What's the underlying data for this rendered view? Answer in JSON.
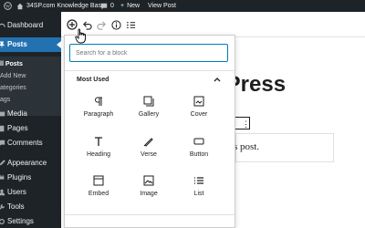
{
  "adminbar": {
    "site_name": "34SP.com Knowledge Base",
    "comments_count": "0",
    "new_label": "New",
    "view_post_label": "View Post"
  },
  "sidebar": {
    "items": [
      {
        "label": "Dashboard",
        "icon": "dashboard-icon"
      },
      {
        "label": "Posts",
        "icon": "pin-icon",
        "active": true
      },
      {
        "label": "Media",
        "icon": "media-icon"
      },
      {
        "label": "Pages",
        "icon": "pages-icon"
      },
      {
        "label": "Comments",
        "icon": "comments-icon"
      },
      {
        "label": "Appearance",
        "icon": "brush-icon"
      },
      {
        "label": "Plugins",
        "icon": "plugin-icon"
      },
      {
        "label": "Users",
        "icon": "users-icon"
      },
      {
        "label": "Tools",
        "icon": "wrench-icon"
      },
      {
        "label": "Settings",
        "icon": "settings-icon"
      }
    ],
    "submenu": [
      "ll Posts",
      "Add New",
      "ategories",
      "ags"
    ]
  },
  "editor": {
    "title_partial": "lPress",
    "paragraph_partial": "s post."
  },
  "inserter": {
    "search_placeholder": "Search for a block",
    "section_label": "Most Used",
    "blocks": [
      {
        "label": "Paragraph",
        "icon": "paragraph-icon"
      },
      {
        "label": "Gallery",
        "icon": "gallery-icon"
      },
      {
        "label": "Cover",
        "icon": "cover-icon"
      },
      {
        "label": "Heading",
        "icon": "heading-icon"
      },
      {
        "label": "Verse",
        "icon": "verse-icon"
      },
      {
        "label": "Button",
        "icon": "button-icon"
      },
      {
        "label": "Embed",
        "icon": "embed-icon"
      },
      {
        "label": "Image",
        "icon": "image-icon"
      },
      {
        "label": "List",
        "icon": "list-icon"
      }
    ]
  },
  "colors": {
    "admin_dark": "#1d2327",
    "accent_blue": "#2271b1",
    "focus_blue": "#007cba"
  }
}
